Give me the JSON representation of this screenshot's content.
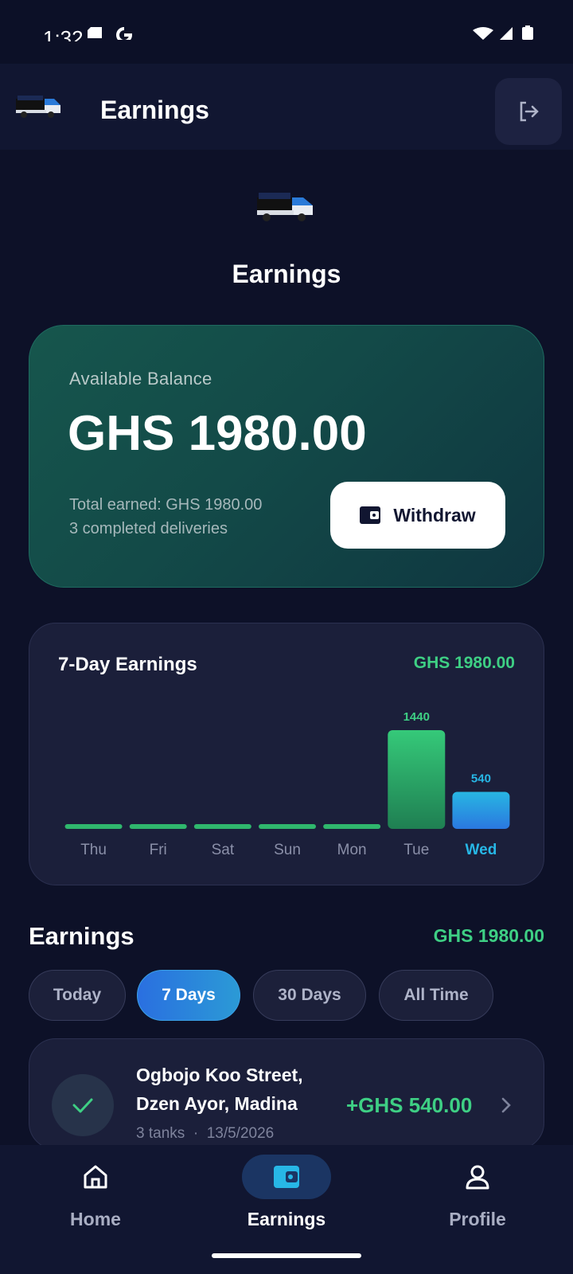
{
  "status_bar": {
    "time": "1:32"
  },
  "header": {
    "title": "Earnings"
  },
  "page": {
    "title": "Earnings"
  },
  "balance": {
    "label": "Available Balance",
    "amount": "GHS 1980.00",
    "total_earned": "Total earned: GHS 1980.00",
    "completed": "3 completed deliveries",
    "withdraw_label": "Withdraw"
  },
  "chart_data": {
    "type": "bar",
    "title": "7-Day Earnings",
    "total": "GHS 1980.00",
    "categories": [
      "Thu",
      "Fri",
      "Sat",
      "Sun",
      "Mon",
      "Tue",
      "Wed"
    ],
    "values": [
      0,
      0,
      0,
      0,
      0,
      1440,
      540
    ],
    "data_labels": [
      "",
      "",
      "",
      "",
      "",
      "1440",
      "540"
    ],
    "highlight": "Wed",
    "colors": {
      "bar": "#2fb76d",
      "highlight": "#2aa7dd",
      "label": "#8a8fa8",
      "highlight_label": "#27b7e6"
    }
  },
  "earnings": {
    "title": "Earnings",
    "total": "GHS 1980.00",
    "filters": [
      "Today",
      "7 Days",
      "30 Days",
      "All Time"
    ],
    "active_filter": "7 Days",
    "items": [
      {
        "address_line1": "Ogbojo Koo Street,",
        "address_line2": "Dzen Ayor, Madina",
        "meta": "3 tanks  ·  13/5/2026",
        "amount": "+GHS 540.00"
      }
    ]
  },
  "nav": {
    "items": [
      {
        "label": "Home",
        "icon": "home-icon"
      },
      {
        "label": "Earnings",
        "icon": "wallet-icon"
      },
      {
        "label": "Profile",
        "icon": "person-icon"
      }
    ],
    "active": "Earnings"
  },
  "colors": {
    "background": "#0d1128",
    "accent_green": "#3ecf84",
    "accent_blue": "#2a6fe0"
  }
}
